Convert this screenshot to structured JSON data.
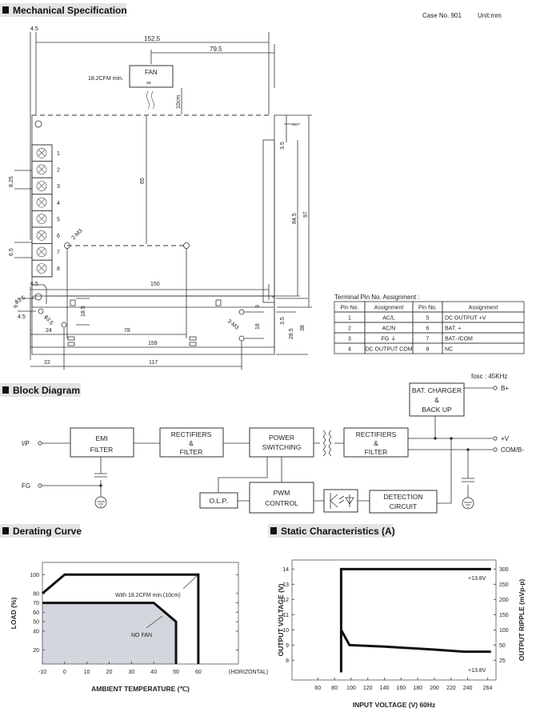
{
  "sections": {
    "mechanical": "Mechanical Specification",
    "block": "Block Diagram",
    "derating": "Derating Curve",
    "static": "Static Characteristics (A)"
  },
  "case_no": "Case No. 901",
  "unit": "Unit:mm",
  "mechanical": {
    "top": {
      "d_4_5_top": "4.5",
      "d_152_5": "152.5",
      "d_79_5": "79.5",
      "d_10cm": "10cm",
      "d_7": "7",
      "d_3_5": "3.5",
      "d_65": "65",
      "d_84_5": "84.5",
      "d_97": "97",
      "d_8_25": "8.25",
      "d_6_5": "6.5",
      "d_2m3": "2-M3",
      "d_phi": "ϕ3.5",
      "d_4_5_bot": "4.5",
      "d_24": "24",
      "d_78": "78",
      "d_159": "159",
      "fan_label": "FAN",
      "fan_symbol": "∞",
      "fan_note": "18.2CFM min.",
      "terminals": [
        "1",
        "2",
        "3",
        "4",
        "5",
        "6",
        "7",
        "8"
      ]
    },
    "side": {
      "d_6_5": "6.5",
      "d_150": "150",
      "d_9_left": "9",
      "d_18_5": "18.5",
      "d_phi": "ϕ3.5",
      "d_9_right": "9",
      "d_18": "18",
      "d_3m3": "3-M3",
      "d_3_5": "3.5",
      "d_28_5": "28.5",
      "d_38": "38",
      "d_22": "22",
      "d_117": "117"
    }
  },
  "pin_table": {
    "title": "Terminal Pin No. Assignment :",
    "headers": [
      "Pin No.",
      "Assignment",
      "Pin No.",
      "Assignment"
    ],
    "rows": [
      [
        "1",
        "AC/L",
        "5",
        "DC OUTPUT +V"
      ],
      [
        "2",
        "AC/N",
        "6",
        "BAT. +"
      ],
      [
        "3",
        "FG ⏚",
        "7",
        "BAT.-/COM"
      ],
      [
        "4",
        "DC OUTPUT COM",
        "8",
        "NC"
      ]
    ]
  },
  "block_diagram": {
    "fosc": "fosc : 45KHz",
    "terminals": {
      "ip": "I/P",
      "fg": "FG",
      "bplus": "B+",
      "vplus": "+V",
      "com": "COM/B-"
    },
    "emi": [
      "EMI",
      "FILTER"
    ],
    "rect1": [
      "RECTIFIERS",
      "&",
      "FILTER"
    ],
    "power": [
      "POWER",
      "SWITCHING"
    ],
    "rect2": [
      "RECTIFIERS",
      "&",
      "FILTER"
    ],
    "bat": [
      "BAT. CHARGER",
      "&",
      "BACK UP"
    ],
    "olp": "O.L.P.",
    "pwm": [
      "PWM",
      "CONTROL"
    ],
    "detect": [
      "DETECTION",
      "CIRCUIT"
    ]
  },
  "chart_data": [
    {
      "type": "line",
      "title": "Derating Curve",
      "xlabel": "AMBIENT TEMPERATURE (℃)",
      "ylabel": "LOAD (%)",
      "x_ticks": [
        -10,
        0,
        10,
        20,
        30,
        40,
        50,
        60
      ],
      "x_extra_label": "(HORIZONTAL)",
      "y_ticks": [
        20,
        40,
        50,
        60,
        70,
        80,
        100
      ],
      "xlim": [
        -10,
        78
      ],
      "ylim": [
        5,
        113
      ],
      "fill_color": "#d3d6dc",
      "series": [
        {
          "annotation": "With 18.2CFM min.(10cm)",
          "points": [
            [
              -10,
              80
            ],
            [
              0,
              100
            ],
            [
              60,
              100
            ],
            [
              60,
              5
            ]
          ]
        },
        {
          "annotation": "NO FAN",
          "filled": true,
          "points": [
            [
              -10,
              70
            ],
            [
              40,
              70
            ],
            [
              50,
              50
            ],
            [
              50,
              5
            ]
          ]
        }
      ]
    },
    {
      "type": "line",
      "title": "Static Characteristics (A)",
      "xlabel": "INPUT VOLTAGE (V) 60Hz",
      "ylabel": "OUTPUT VOLTAGE (V)",
      "y2label": "OUTPUT RIPPLE (mVp-p)",
      "x_ticks": [
        60,
        80,
        100,
        120,
        140,
        160,
        180,
        200,
        220,
        240,
        264
      ],
      "y_ticks": [
        8,
        9,
        10,
        11,
        12,
        13,
        14
      ],
      "y2_ticks": [
        25,
        50,
        100,
        150,
        200,
        250,
        300
      ],
      "xlim": [
        29,
        274
      ],
      "ylim": [
        6.7,
        14.6
      ],
      "series": [
        {
          "axis": "left",
          "annotation": "+13.8V",
          "points": [
            [
              88,
              7.2
            ],
            [
              88,
              14
            ],
            [
              268,
              14
            ]
          ]
        },
        {
          "axis": "right",
          "annotation": "+13.8V",
          "points": [
            [
              88,
              100
            ],
            [
              98,
              50
            ],
            [
              140,
              45
            ],
            [
              200,
              35
            ],
            [
              236,
              28
            ],
            [
              268,
              28
            ]
          ]
        }
      ]
    }
  ]
}
